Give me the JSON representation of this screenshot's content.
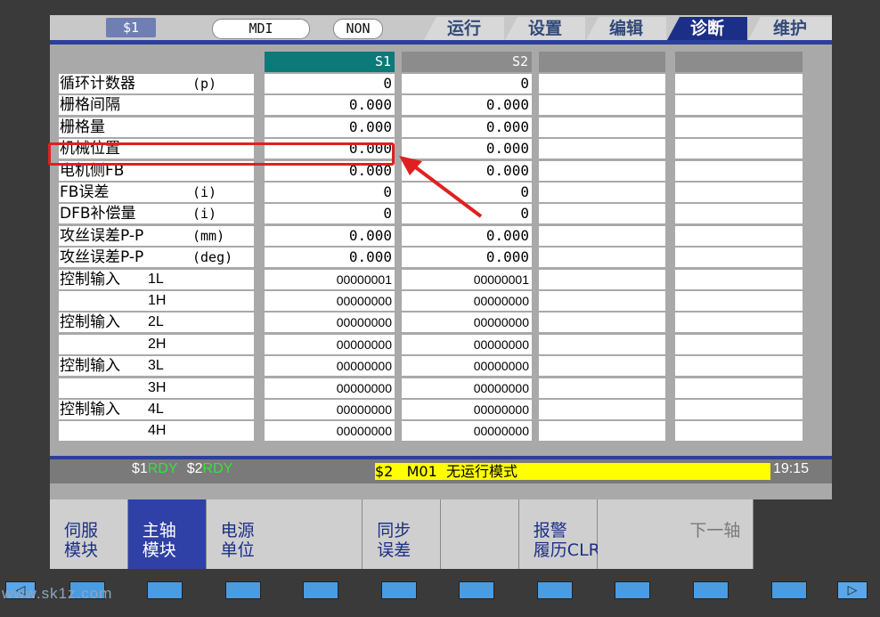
{
  "topbar": {
    "system": "$1",
    "mode": "MDI",
    "status": "NON",
    "tabs": [
      {
        "label": "运行",
        "active": false
      },
      {
        "label": "设置",
        "active": false
      },
      {
        "label": "编辑",
        "active": false
      },
      {
        "label": "诊断",
        "active": true
      },
      {
        "label": "维护",
        "active": false
      }
    ]
  },
  "table": {
    "columns": [
      "S1",
      "S2",
      "",
      ""
    ],
    "rows": [
      {
        "label": "循环计数器",
        "unit": "(p)",
        "s1": "0",
        "s2": "0"
      },
      {
        "label": "栅格间隔",
        "unit": "",
        "s1": "0.000",
        "s2": "0.000"
      },
      {
        "label": "栅格量",
        "unit": "",
        "s1": "0.000",
        "s2": "0.000"
      },
      {
        "label": "机械位置",
        "unit": "",
        "s1": "0.000",
        "s2": "0.000"
      },
      {
        "label": "电机侧FB",
        "unit": "",
        "s1": "0.000",
        "s2": "0.000"
      },
      {
        "label": "FB误差",
        "unit": "(i)",
        "s1": "0",
        "s2": "0"
      },
      {
        "label": "DFB补偿量",
        "unit": "(i)",
        "s1": "0",
        "s2": "0"
      },
      {
        "label": "攻丝误差P-P",
        "unit": "(mm)",
        "s1": "0.000",
        "s2": "0.000"
      },
      {
        "label": "攻丝误差P-P",
        "unit": "(deg)",
        "s1": "0.000",
        "s2": "0.000"
      },
      {
        "label": "控制输入",
        "sub": "1L",
        "s1": "00000001",
        "s2": "00000001"
      },
      {
        "label": "",
        "sub": "1H",
        "s1": "00000000",
        "s2": "00000000"
      },
      {
        "label": "控制输入",
        "sub": "2L",
        "s1": "00000000",
        "s2": "00000000"
      },
      {
        "label": "",
        "sub": "2H",
        "s1": "00000000",
        "s2": "00000000"
      },
      {
        "label": "控制输入",
        "sub": "3L",
        "s1": "00000000",
        "s2": "00000000"
      },
      {
        "label": "",
        "sub": "3H",
        "s1": "00000000",
        "s2": "00000000"
      },
      {
        "label": "控制输入",
        "sub": "4L",
        "s1": "00000000",
        "s2": "00000000"
      },
      {
        "label": "",
        "sub": "4H",
        "s1": "00000000",
        "s2": "00000000"
      }
    ]
  },
  "status": {
    "sys1": "$1",
    "sys1_state": "RDY",
    "sys2": "$2",
    "sys2_state": "RDY",
    "message": "$2   M01  无运行模式",
    "time": "19:15"
  },
  "softkeys": [
    {
      "label": "伺服\n模块",
      "active": false,
      "disabled": false
    },
    {
      "label": "主轴\n模块",
      "active": true,
      "disabled": false
    },
    {
      "label": "电源\n单位",
      "active": false,
      "disabled": false
    },
    {
      "label": "",
      "active": false,
      "disabled": false
    },
    {
      "label": "同步\n误差",
      "active": false,
      "disabled": false
    },
    {
      "label": "",
      "active": false,
      "disabled": false
    },
    {
      "label": "报警\n履历CLR",
      "active": false,
      "disabled": false
    },
    {
      "label": "",
      "active": false,
      "disabled": false
    },
    {
      "label": "下一轴",
      "active": false,
      "disabled": true
    },
    {
      "label": "",
      "active": false,
      "disabled": false
    }
  ],
  "watermark": "www.sk1z.com",
  "colors": {
    "accent_blue": "#2c3f9a",
    "header_teal": "#0b7a78",
    "header_gray": "#8c8c8c",
    "highlight_red": "#e02020",
    "message_yellow": "#ffff00",
    "rdy_green": "#39e03a"
  }
}
